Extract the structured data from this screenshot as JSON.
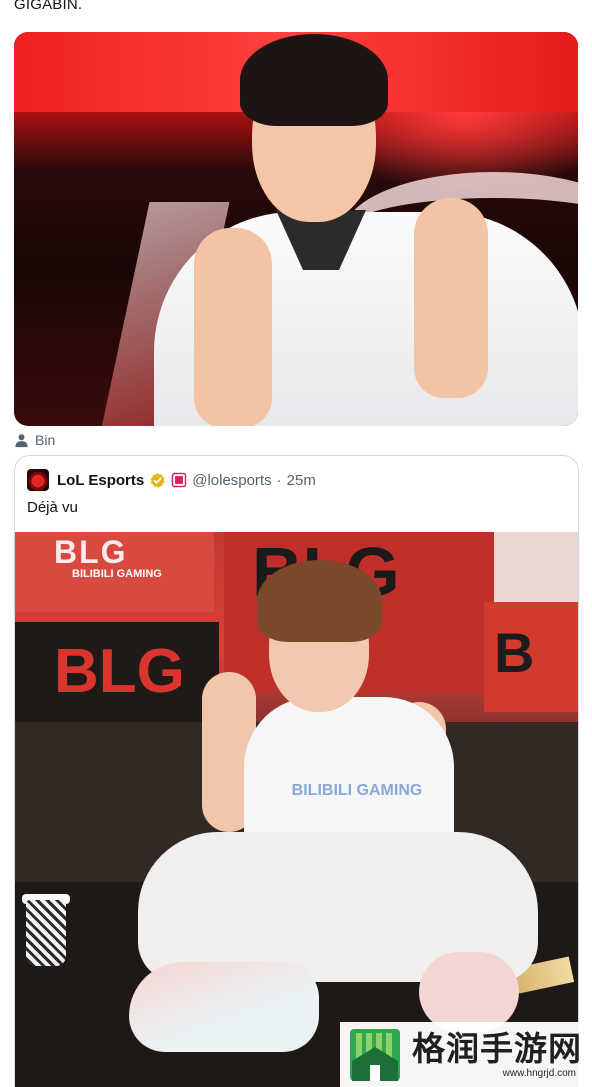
{
  "post": {
    "top_text": "GIGABIN.",
    "photo_credit": "Bin"
  },
  "quoted_tweet": {
    "display_name": "LoL Esports",
    "handle": "@lolesports",
    "separator": "·",
    "time": "25m",
    "text": "Déjà vu"
  },
  "photo2_backdrop": {
    "banner_logo_1": "BLG",
    "banner_sub_1": "BILIBILI GAMING",
    "banner_logo_2": "BLG",
    "banner_logo_3": "BLG",
    "banner_logo_4": "B",
    "shirt_text": "BILIBILI GAMING"
  },
  "watermark": {
    "title": "格润手游网",
    "url": "www.hngrjd.com"
  },
  "colors": {
    "verified": "#e2b719",
    "org_badge": "#e0245e",
    "muted_text": "#536471",
    "card_border": "#cfd9de"
  },
  "icons": {
    "credit": "person-icon",
    "verified": "verified-badge-icon",
    "org": "org-badge-icon"
  }
}
